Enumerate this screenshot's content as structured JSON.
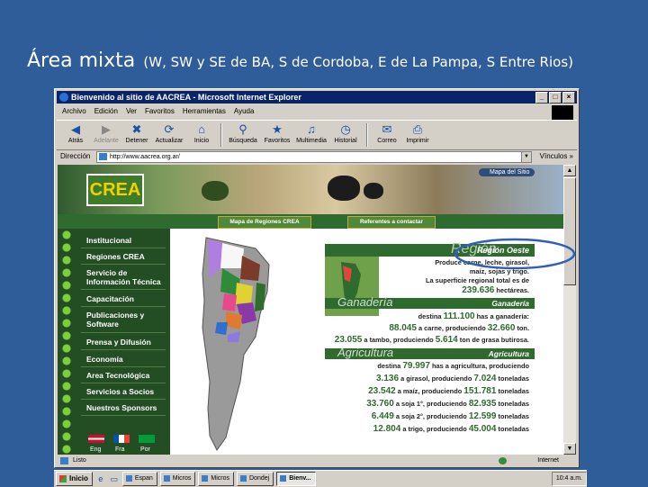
{
  "slide": {
    "title": "Área mixta",
    "subtitle": "(W, SW y SE de BA, S de Cordoba, E de La Pampa, S Entre Rios)"
  },
  "window": {
    "title": "Bienvenido al sitio de AACREA - Microsoft Internet Explorer",
    "menu": [
      "Archivo",
      "Edición",
      "Ver",
      "Favoritos",
      "Herramientas",
      "Ayuda"
    ],
    "toolbar": {
      "back": "Atrás",
      "forward": "Adelante",
      "stop": "Detener",
      "refresh": "Actualizar",
      "home": "Inicio",
      "search": "Búsqueda",
      "favorites": "Favoritos",
      "media": "Multimedia",
      "history": "Historial",
      "mail": "Correo",
      "print": "Imprimir"
    },
    "address_label": "Dirección",
    "address": "http://www.aacrea.org.ar/",
    "links_label": "Vínculos »",
    "status_left": "Listo",
    "status_zone": "Internet"
  },
  "site": {
    "logo": "CREA",
    "map_site": "Mapa del Sitio",
    "nav_map": "Mapa de Regiones CREA",
    "nav_contact": "Referentes a contactar",
    "sidebar": [
      "Institucional",
      "Regiones CREA",
      "Servicio de Información Técnica",
      "Capacitación",
      "Publicaciones y Software",
      "Prensa y Difusión",
      "Economía",
      "Area Tecnológica",
      "Servicios a Socios",
      "Nuestros Sponsors"
    ],
    "languages": [
      "Eng",
      "Fra",
      "Por"
    ]
  },
  "region": {
    "title": "Región Oeste",
    "ghost": "Región",
    "intro": [
      "Produce carne, leche, girasol,",
      "maíz, sojas y trigo.",
      "La superficie regional total es de"
    ],
    "total_area": "239.636",
    "total_area_unit": "hectáreas.",
    "ganaderia": {
      "title": "Ganadería",
      "destina": "destina",
      "total": "111.100",
      "total_text": "has a ganadería:",
      "carne_has": "88.045",
      "carne_text": "a carne, produciendo",
      "carne_prod": "32.660",
      "carne_unit": "ton.",
      "tambo_has": "23.055",
      "tambo_text": "a tambo, produciendo",
      "tambo_prod": "5.614",
      "tambo_unit": "ton de grasa butirosa."
    },
    "agricultura": {
      "title": "Agricultura",
      "destina": "destina",
      "total": "79.997",
      "total_text": "has a agricultura, produciendo",
      "rows": [
        {
          "has": "3.136",
          "text": "a girasol, produciendo",
          "prod": "7.024",
          "unit": "toneladas"
        },
        {
          "has": "23.542",
          "text": "a maíz, produciendo",
          "prod": "151.781",
          "unit": "toneladas"
        },
        {
          "has": "33.760",
          "text": "a soja 1°, produciendo",
          "prod": "82.935",
          "unit": "toneladas"
        },
        {
          "has": "6.449",
          "text": "a soja 2°, produciendo",
          "prod": "12.599",
          "unit": "toneladas"
        },
        {
          "has": "12.804",
          "text": "a trigo, produciendo",
          "prod": "45.004",
          "unit": "toneladas"
        }
      ]
    }
  },
  "taskbar": {
    "start": "Inicio",
    "tasks": [
      "Espan",
      "Micros",
      "Micros",
      "Dondej",
      "Bienv..."
    ],
    "active_index": 4,
    "tray": "10:4 a.m."
  }
}
